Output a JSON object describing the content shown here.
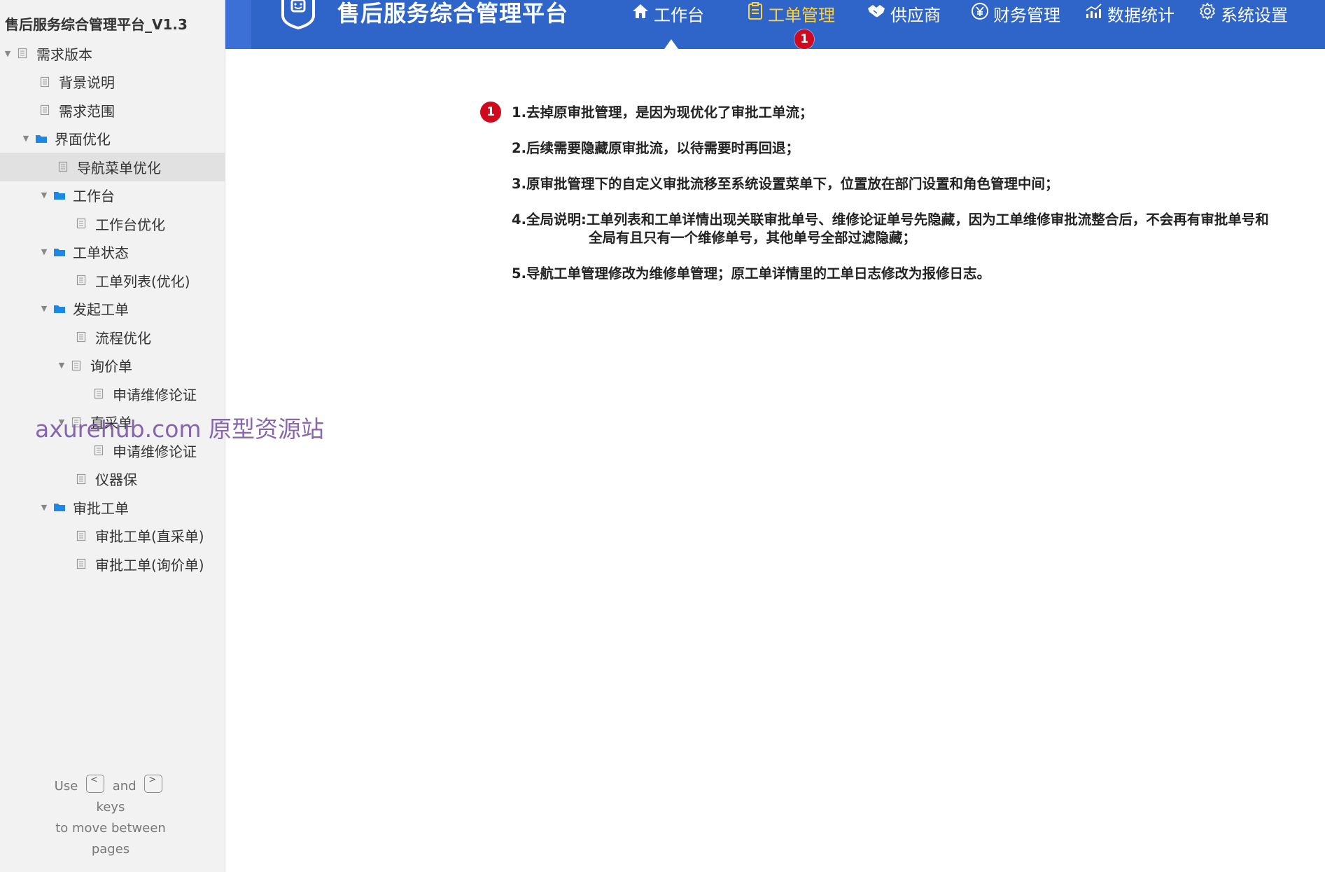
{
  "sidebar": {
    "project_title": "售后服务综合管理平台_V1.3",
    "items": [
      {
        "label": "需求版本",
        "type": "page",
        "level": 0,
        "expanded": true,
        "selected": false
      },
      {
        "label": "背景说明",
        "type": "page",
        "level": 1,
        "expanded": null,
        "selected": false
      },
      {
        "label": "需求范围",
        "type": "page",
        "level": 1,
        "expanded": null,
        "selected": false
      },
      {
        "label": "界面优化",
        "type": "folder",
        "level": 1,
        "expanded": true,
        "selected": false
      },
      {
        "label": "导航菜单优化",
        "type": "page",
        "level": 2,
        "expanded": null,
        "selected": true
      },
      {
        "label": "工作台",
        "type": "folder",
        "level": 2,
        "expanded": true,
        "selected": false
      },
      {
        "label": "工作台优化",
        "type": "page",
        "level": 3,
        "expanded": null,
        "selected": false
      },
      {
        "label": "工单状态",
        "type": "folder",
        "level": 2,
        "expanded": true,
        "selected": false
      },
      {
        "label": "工单列表(优化)",
        "type": "page",
        "level": 3,
        "expanded": null,
        "selected": false
      },
      {
        "label": "发起工单",
        "type": "folder",
        "level": 2,
        "expanded": true,
        "selected": false
      },
      {
        "label": "流程优化",
        "type": "page",
        "level": 3,
        "expanded": null,
        "selected": false
      },
      {
        "label": "询价单",
        "type": "page",
        "level": 3,
        "expanded": true,
        "selected": false
      },
      {
        "label": "申请维修论证",
        "type": "page",
        "level": 4,
        "expanded": null,
        "selected": false
      },
      {
        "label": "直采单",
        "type": "page",
        "level": 3,
        "expanded": true,
        "selected": false
      },
      {
        "label": "申请维修论证",
        "type": "page",
        "level": 4,
        "expanded": null,
        "selected": false
      },
      {
        "label": "仪器保",
        "type": "page",
        "level": 3,
        "expanded": null,
        "selected": false
      },
      {
        "label": "审批工单",
        "type": "folder",
        "level": 2,
        "expanded": true,
        "selected": false
      },
      {
        "label": "审批工单(直采单)",
        "type": "page",
        "level": 3,
        "expanded": null,
        "selected": false
      },
      {
        "label": "审批工单(询价单)",
        "type": "page",
        "level": 3,
        "expanded": null,
        "selected": false
      }
    ],
    "help": {
      "use": "Use",
      "and": "and",
      "keys": "keys",
      "move": "to move between",
      "pages": "pages",
      "prev_key": "<",
      "next_key": ">"
    }
  },
  "watermark": "axurehub.com 原型资源站",
  "header": {
    "app_title": "售后服务综合管理平台",
    "nav": [
      {
        "label": "工作台",
        "icon": "home-icon",
        "active": false
      },
      {
        "label": "工单管理",
        "icon": "document-icon",
        "active": true
      },
      {
        "label": "供应商",
        "icon": "handshake-icon",
        "active": false
      },
      {
        "label": "财务管理",
        "icon": "yen-icon",
        "active": false
      },
      {
        "label": "数据统计",
        "icon": "chart-icon",
        "active": false
      },
      {
        "label": "系统设置",
        "icon": "gear-icon",
        "active": false
      }
    ],
    "badge": "1"
  },
  "notes": {
    "badge": "1",
    "items": [
      "1.去掉原审批管理，是因为现优化了审批工单流；",
      "2.后续需要隐藏原审批流，以待需要时再回退；",
      "3.原审批管理下的自定义审批流移至系统设置菜单下，位置放在部门设置和角色管理中间；",
      "4.全局说明:工单列表和工单详情出现关联审批单号、维修论证单号先隐藏，因为工单维修审批流整合后，不会再有审批单号和",
      "5.导航工单管理修改为维修单管理；原工单详情里的工单日志修改为报修日志。"
    ],
    "item4_continuation": "全局有且只有一个维修单号，其他单号全部过滤隐藏；"
  },
  "colors": {
    "header_bg": "#2f64c8",
    "active_nav": "#ffd23c",
    "badge_red": "#cf0a1e",
    "folder_blue": "#1e88e5"
  }
}
